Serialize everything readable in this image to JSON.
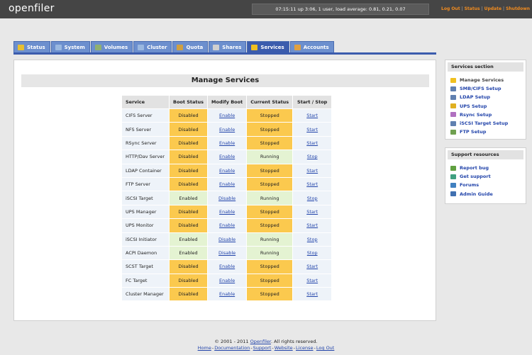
{
  "header": {
    "logo": "openfiler",
    "uptime": "07:15:11 up 3:06, 1 user, load average: 0.81, 0.21, 0.07",
    "links": [
      "Log Out",
      "Status",
      "Update",
      "Shutdown"
    ]
  },
  "tabs": [
    {
      "label": "Status",
      "icon": "status-icon",
      "color": "#e8c030"
    },
    {
      "label": "System",
      "icon": "system-icon",
      "color": "#9ab8e0"
    },
    {
      "label": "Volumes",
      "icon": "volumes-icon",
      "color": "#90b070"
    },
    {
      "label": "Cluster",
      "icon": "cluster-icon",
      "color": "#9ab8e0"
    },
    {
      "label": "Quota",
      "icon": "quota-icon",
      "color": "#d0a040"
    },
    {
      "label": "Shares",
      "icon": "shares-icon",
      "color": "#d0d0d0"
    },
    {
      "label": "Services",
      "icon": "services-icon",
      "color": "#f0c020"
    },
    {
      "label": "Accounts",
      "icon": "accounts-icon",
      "color": "#e0a040"
    }
  ],
  "main": {
    "title": "Manage Services",
    "columns": [
      "Service",
      "Boot Status",
      "Modify Boot",
      "Current Status",
      "Start / Stop"
    ],
    "rows": [
      {
        "service": "CIFS Server",
        "boot": "Disabled",
        "modify": "Enable",
        "current": "Stopped",
        "action": "Start"
      },
      {
        "service": "NFS Server",
        "boot": "Disabled",
        "modify": "Enable",
        "current": "Stopped",
        "action": "Start"
      },
      {
        "service": "RSync Server",
        "boot": "Disabled",
        "modify": "Enable",
        "current": "Stopped",
        "action": "Start"
      },
      {
        "service": "HTTP/Dav Server",
        "boot": "Disabled",
        "modify": "Enable",
        "current": "Running",
        "action": "Stop"
      },
      {
        "service": "LDAP Container",
        "boot": "Disabled",
        "modify": "Enable",
        "current": "Stopped",
        "action": "Start"
      },
      {
        "service": "FTP Server",
        "boot": "Disabled",
        "modify": "Enable",
        "current": "Stopped",
        "action": "Start"
      },
      {
        "service": "iSCSI Target",
        "boot": "Enabled",
        "modify": "Disable",
        "current": "Running",
        "action": "Stop"
      },
      {
        "service": "UPS Manager",
        "boot": "Disabled",
        "modify": "Enable",
        "current": "Stopped",
        "action": "Start"
      },
      {
        "service": "UPS Monitor",
        "boot": "Disabled",
        "modify": "Enable",
        "current": "Stopped",
        "action": "Start"
      },
      {
        "service": "iSCSI Initiator",
        "boot": "Enabled",
        "modify": "Disable",
        "current": "Running",
        "action": "Stop"
      },
      {
        "service": "ACPI Daemon",
        "boot": "Enabled",
        "modify": "Disable",
        "current": "Running",
        "action": "Stop"
      },
      {
        "service": "SCST Target",
        "boot": "Disabled",
        "modify": "Enable",
        "current": "Stopped",
        "action": "Start"
      },
      {
        "service": "FC Target",
        "boot": "Disabled",
        "modify": "Enable",
        "current": "Stopped",
        "action": "Start"
      },
      {
        "service": "Cluster Manager",
        "boot": "Disabled",
        "modify": "Enable",
        "current": "Stopped",
        "action": "Start"
      }
    ]
  },
  "sidebar": {
    "services_section": {
      "title": "Services section",
      "items": [
        {
          "label": "Manage Services",
          "icon": "services-icon",
          "color": "#f0c020"
        },
        {
          "label": "SMB/CIFS Setup",
          "icon": "smb-icon",
          "color": "#6080b0"
        },
        {
          "label": "LDAP Setup",
          "icon": "ldap-icon",
          "color": "#6080b0"
        },
        {
          "label": "UPS Setup",
          "icon": "ups-icon",
          "color": "#e0b020"
        },
        {
          "label": "Rsync Setup",
          "icon": "rsync-icon",
          "color": "#b070c0"
        },
        {
          "label": "iSCSI Target Setup",
          "icon": "iscsi-icon",
          "color": "#6080b0"
        },
        {
          "label": "FTP Setup",
          "icon": "ftp-icon",
          "color": "#70a050"
        }
      ]
    },
    "support": {
      "title": "Support resources",
      "items": [
        {
          "label": "Report bug",
          "icon": "bug-icon",
          "color": "#60a040"
        },
        {
          "label": "Get support",
          "icon": "support-icon",
          "color": "#40a080"
        },
        {
          "label": "Forums",
          "icon": "forums-icon",
          "color": "#4080c0"
        },
        {
          "label": "Admin Guide",
          "icon": "guide-icon",
          "color": "#4070b0"
        }
      ]
    }
  },
  "footer": {
    "copyright_prefix": "© 2001 - 2011 ",
    "copyright_link": "Openfiler",
    "copyright_suffix": ". All rights reserved.",
    "links": [
      "Home",
      "Documentation",
      "Support",
      "Website",
      "License",
      "Log Out"
    ]
  }
}
